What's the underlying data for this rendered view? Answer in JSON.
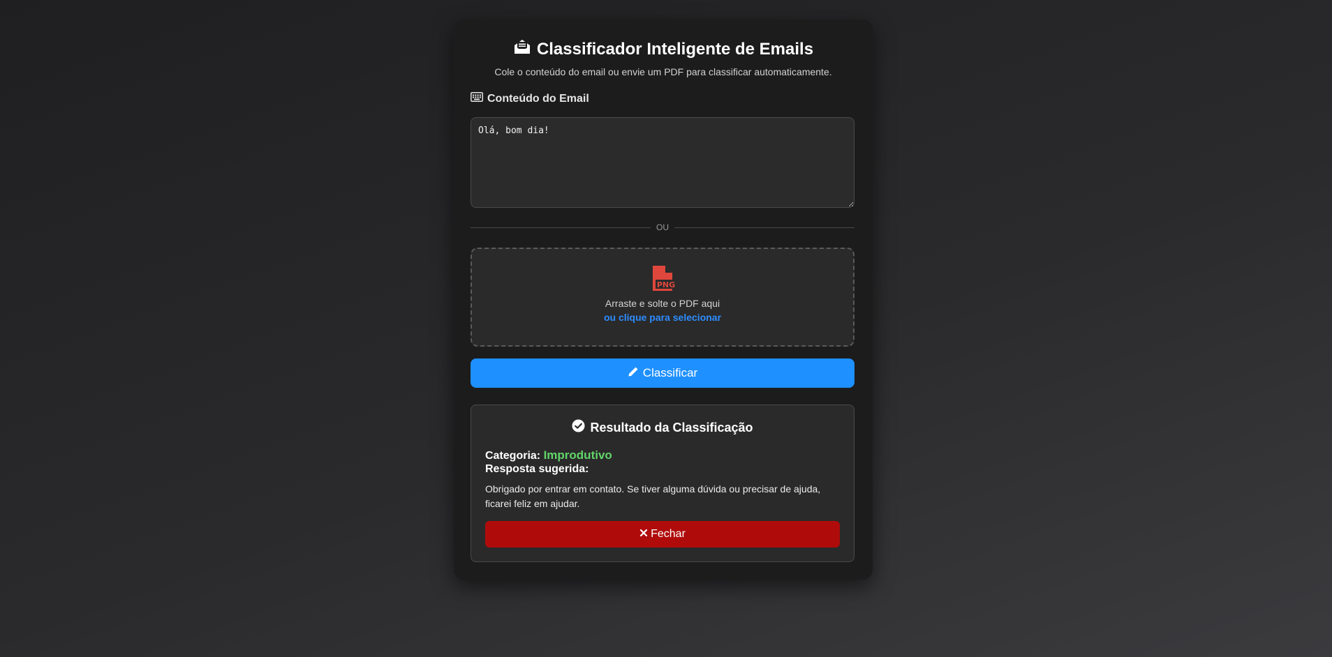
{
  "header": {
    "title": "Classificador Inteligente de Emails",
    "subtitle": "Cole o conteúdo do email ou envie um PDF para classificar automaticamente.",
    "icon": "envelope-open-text-icon"
  },
  "email_field": {
    "label": "Conteúdo do Email",
    "icon": "keyboard-icon",
    "value": "Olá, bom dia!"
  },
  "divider": {
    "label": "OU"
  },
  "dropzone": {
    "icon": "file-png-icon",
    "icon_text": "PNG",
    "text": "Arraste e solte o PDF aqui",
    "link": "ou clique para selecionar"
  },
  "classify_button": {
    "label": "Classificar",
    "icon": "pen-icon",
    "color": "#1e90ff"
  },
  "result": {
    "title": "Resultado da Classificação",
    "icon": "circle-check-icon",
    "category_label": "Categoria:",
    "category_value": "Improdutivo",
    "category_color": "#62d66a",
    "response_label": "Resposta sugerida:",
    "response_text": "Obrigado por entrar em contato. Se tiver alguma dúvida ou precisar de ajuda, ficarei feliz em ajudar.",
    "close_button": {
      "label": "Fechar",
      "icon": "x-icon",
      "color": "#b00b0b"
    }
  }
}
